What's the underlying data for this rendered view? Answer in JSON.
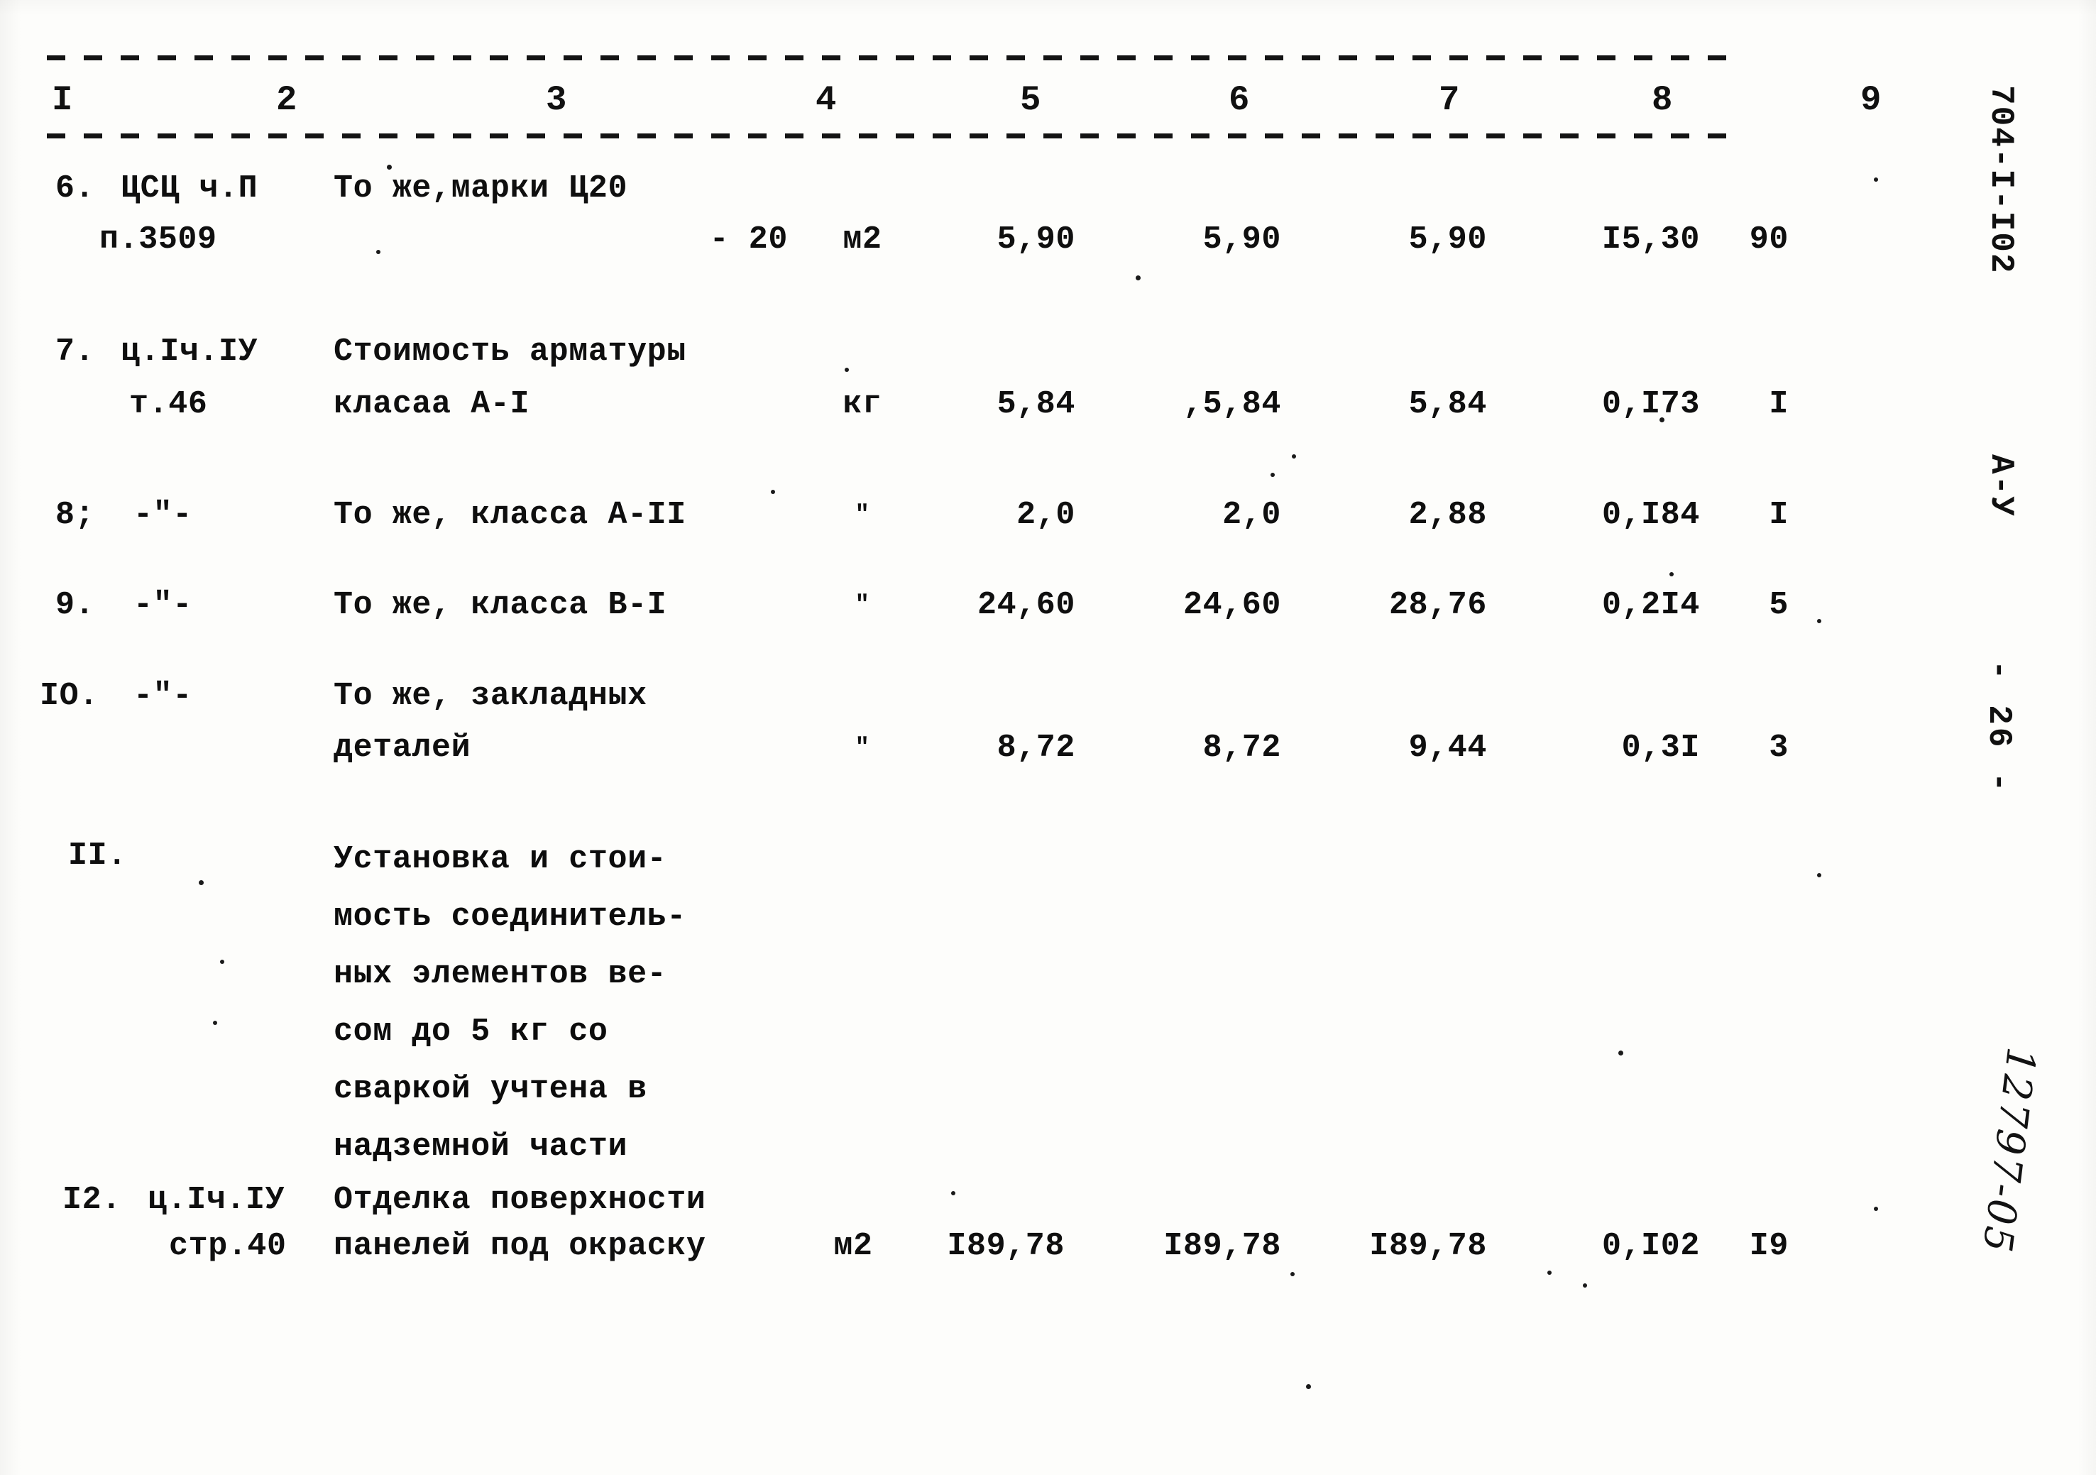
{
  "document": {
    "doc_code": "704-I-I02",
    "series_code": "А-У",
    "page_number": "- 26 -",
    "archive_number": "12797-05"
  },
  "table": {
    "column_numbers": [
      "I",
      "2",
      "3",
      "4",
      "5",
      "6",
      "7",
      "8",
      "9"
    ],
    "rows": [
      {
        "no": "6.",
        "ref_line1": "ЦСЦ ч.П",
        "ref_line2": "п.3509",
        "desc_line1": "То же,марки Ц20",
        "desc_line2": "- 20",
        "unit": "м2",
        "v1": "5,90",
        "v2": "5,90",
        "v3": "5,90",
        "v4": "I5,30",
        "v5": "90"
      },
      {
        "no": "7.",
        "ref_line1": "ц.Iч.IУ",
        "ref_line2": "т.46",
        "desc_line1": "Стоимость арматуры",
        "desc_line2": "класаа А-I",
        "unit": "кг",
        "v1": "5,84",
        "v2": ",5,84",
        "v3": "5,84",
        "v4": "0,I73",
        "v5": "I"
      },
      {
        "no": "8;",
        "ref_line1": "-\"-",
        "ref_line2": "",
        "desc_line1": "То же, класса А-II",
        "desc_line2": "",
        "unit": "\"",
        "v1": "2,0",
        "v2": "2,0",
        "v3": "2,88",
        "v4": "0,I84",
        "v5": "I"
      },
      {
        "no": "9.",
        "ref_line1": "-\"-",
        "ref_line2": "",
        "desc_line1": "То же, класса В-I",
        "desc_line2": "",
        "unit": "\"",
        "v1": "24,60",
        "v2": "24,60",
        "v3": "28,76",
        "v4": "0,2I4",
        "v5": "5"
      },
      {
        "no": "IO.",
        "ref_line1": "-\"-",
        "ref_line2": "",
        "desc_line1": "То же, закладных",
        "desc_line2": "деталей",
        "unit": "\"",
        "v1": "8,72",
        "v2": "8,72",
        "v3": "9,44",
        "v4": "0,3I",
        "v5": "3"
      },
      {
        "no": "II.",
        "ref_line1": "",
        "ref_line2": "",
        "desc_lines": [
          "Установка и стои-",
          "мость соединитель-",
          "ных элементов ве-",
          "сом до 5 кг со",
          "сваркой учтена в",
          "надземной части"
        ],
        "unit": "",
        "v1": "",
        "v2": "",
        "v3": "",
        "v4": "",
        "v5": ""
      },
      {
        "no": "I2.",
        "ref_line1": "ц.Iч.IУ",
        "ref_line2": "стр.40",
        "desc_line1": "Отделка поверхности",
        "desc_line2": "панелей под окраску",
        "unit": "м2",
        "v1": "I89,78",
        "v2": "I89,78",
        "v3": "I89,78",
        "v4": "0,I02",
        "v5": "I9"
      }
    ]
  }
}
